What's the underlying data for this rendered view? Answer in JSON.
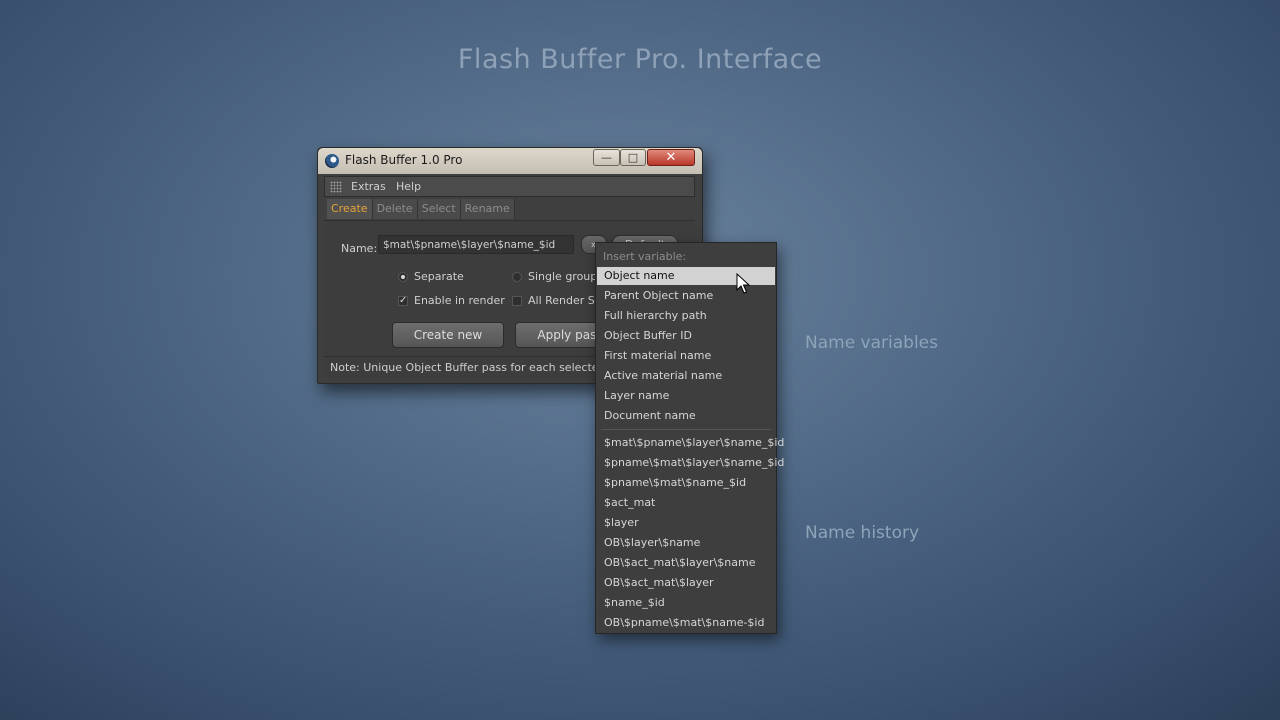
{
  "headline": "Flash Buffer Pro. Interface",
  "side_labels": {
    "name_variables": "Name variables",
    "name_history": "Name history"
  },
  "window": {
    "title": "Flash Buffer 1.0 Pro",
    "controls": {
      "minimize": "—",
      "maximize": "□",
      "close": "✕"
    },
    "menu": [
      "Extras",
      "Help"
    ],
    "tabs": [
      "Create",
      "Delete",
      "Select",
      "Rename"
    ],
    "active_tab": "Create",
    "name_label": "Name:",
    "name_value": "$mat\\$pname\\$layer\\$name_$id",
    "arrow_button": "»",
    "default_button": "Default",
    "options": {
      "separate": "Separate",
      "single_group": "Single group",
      "enable_in_render": "Enable in render",
      "all_render_settings": "All Render Settings"
    },
    "option_states": {
      "separate_selected": true,
      "single_group_selected": false,
      "enable_in_render_checked": true,
      "all_render_settings_checked": false
    },
    "buttons": {
      "create_new": "Create new",
      "apply_pass": "Apply pass"
    },
    "note": "Note: Unique Object Buffer pass for each selected object"
  },
  "dropdown": {
    "header": "Insert variable:",
    "variables": [
      "Object name",
      "Parent Object name",
      "Full hierarchy path",
      "Object Buffer ID",
      "First material name",
      "Active material name",
      "Layer name",
      "Document name"
    ],
    "highlighted_index": 0,
    "history": [
      "$mat\\$pname\\$layer\\$name_$id",
      "$pname\\$mat\\$layer\\$name_$id",
      "$pname\\$mat\\$name_$id",
      "$act_mat",
      "$layer",
      "OB\\$layer\\$name",
      "OB\\$act_mat\\$layer\\$name",
      "OB\\$act_mat\\$layer",
      "$name_$id",
      "OB\\$pname\\$mat\\$name-$id"
    ]
  },
  "icons": {
    "app": "cinema4d-logo-icon",
    "menu_grip": "grip-icon",
    "cursor": "mouse-pointer-icon"
  },
  "colors": {
    "active_tab": "#e8a33a",
    "highlight": "#d2d2d2",
    "close_button": "#b9382a"
  }
}
